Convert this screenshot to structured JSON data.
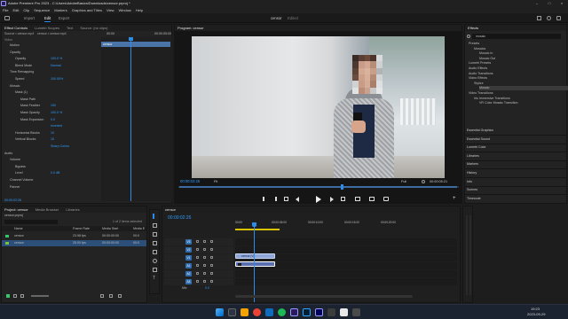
{
  "window": {
    "title": "Adobe Premiere Pro 2023 - C:\\Users\\AdobeBasics\\Downloads\\censor.prproj *"
  },
  "menu": [
    "File",
    "Edit",
    "Clip",
    "Sequence",
    "Markers",
    "Graphics and Titles",
    "View",
    "Window",
    "Help"
  ],
  "workspaces": {
    "import": "Import",
    "edit": "Edit",
    "export": "Export",
    "center_title": "censor",
    "center_sub": "Edited"
  },
  "effect_controls": {
    "tabs": [
      "Effect Controls",
      "Lumetri Scopes",
      "Text",
      "Source: (no clips)"
    ],
    "source_label": "Source • censor.mp4",
    "seq_label": "censor • censor.mp4",
    "tc_start": "00:00",
    "tc_end": "00:00:05:00",
    "clip_label": "censor",
    "video_header": "Video",
    "rows": [
      {
        "label": "Motion",
        "value": ""
      },
      {
        "label": "Opacity",
        "value": ""
      },
      {
        "label": "Opacity",
        "value": "100.0 %"
      },
      {
        "label": "Blend Mode",
        "value": "Normal"
      },
      {
        "label": "Time Remapping",
        "value": ""
      },
      {
        "label": "Speed",
        "value": "100.00%"
      },
      {
        "label": "Mosaic",
        "value": ""
      },
      {
        "label": "Mask (1)",
        "value": ""
      },
      {
        "label": "Mask Path",
        "value": ""
      },
      {
        "label": "Mask Feather",
        "value": "100"
      },
      {
        "label": "Mask Opacity",
        "value": "100.0 %"
      },
      {
        "label": "Mask Expansion",
        "value": "0.0"
      },
      {
        "label": "",
        "value": "Inverted"
      },
      {
        "label": "Horizontal Blocks",
        "value": "10"
      },
      {
        "label": "Vertical Blocks",
        "value": "10"
      },
      {
        "label": "",
        "value": "Sharp Colors"
      },
      {
        "label": "Audio",
        "value": ""
      },
      {
        "label": "Volume",
        "value": ""
      },
      {
        "label": "Bypass",
        "value": ""
      },
      {
        "label": "Level",
        "value": "0.0 dB"
      },
      {
        "label": "Channel Volume",
        "value": ""
      },
      {
        "label": "Panner",
        "value": ""
      }
    ],
    "footer_tc": "00:00:02:26"
  },
  "program": {
    "title": "Program: censor",
    "timecode": "00:00:02:26",
    "fit": "Fit",
    "quality": "Full",
    "duration": "00:00:05:21"
  },
  "project": {
    "tabs": [
      "Project: censor",
      "Media Browser",
      "Libraries"
    ],
    "file": "censor.prproj",
    "selected": "1 of 2 items selected",
    "columns": [
      "Name",
      "Frame Rate",
      "Media Start",
      "Media E"
    ],
    "items": [
      {
        "name": "censor",
        "rate": "23.98 fps",
        "start": "00:00:00:00",
        "end": "00:0",
        "color": "#36c76b"
      },
      {
        "name": "censor",
        "rate": "25.00 fps",
        "start": "00:00:00:00",
        "end": "00:0",
        "color": "#7ac143"
      }
    ]
  },
  "timeline": {
    "name": "censor",
    "timecode": "00:00:02:26",
    "ruler": [
      "00:00",
      "00:00:05:00",
      "00:00:10:00",
      "00:00:15:00",
      "00:00:20:00"
    ],
    "video_tracks": [
      "V3",
      "V2",
      "V1"
    ],
    "audio_tracks": [
      "A1",
      "A2",
      "A3"
    ],
    "mix": "Mix",
    "mix_val": "0.0",
    "clip_v1": "censor [V]",
    "clip_a1": ""
  },
  "effects": {
    "title": "Effects",
    "search": "mosaic",
    "tree": [
      {
        "label": "Presets",
        "indent": 0
      },
      {
        "label": "Mosaics",
        "indent": 1
      },
      {
        "label": "Mosaic In",
        "indent": 2
      },
      {
        "label": "Mosaic Out",
        "indent": 2
      },
      {
        "label": "Lumetri Presets",
        "indent": 0
      },
      {
        "label": "Audio Effects",
        "indent": 0
      },
      {
        "label": "Audio Transitions",
        "indent": 0
      },
      {
        "label": "Video Effects",
        "indent": 0
      },
      {
        "label": "Stylize",
        "indent": 1
      },
      {
        "label": "Mosaic",
        "indent": 2
      },
      {
        "label": "Video Transitions",
        "indent": 0
      },
      {
        "label": "Iris Immersive Transitions",
        "indent": 1
      },
      {
        "label": "VR Color Mosaic Transition",
        "indent": 2
      }
    ],
    "sections": [
      "Essential Graphics",
      "Essential Sound",
      "Lumetri Color",
      "Libraries",
      "Markers",
      "History",
      "Info",
      "Scenes",
      "Timecode"
    ]
  },
  "taskbar": {
    "time": "19:23",
    "date": "2023-09-29"
  }
}
